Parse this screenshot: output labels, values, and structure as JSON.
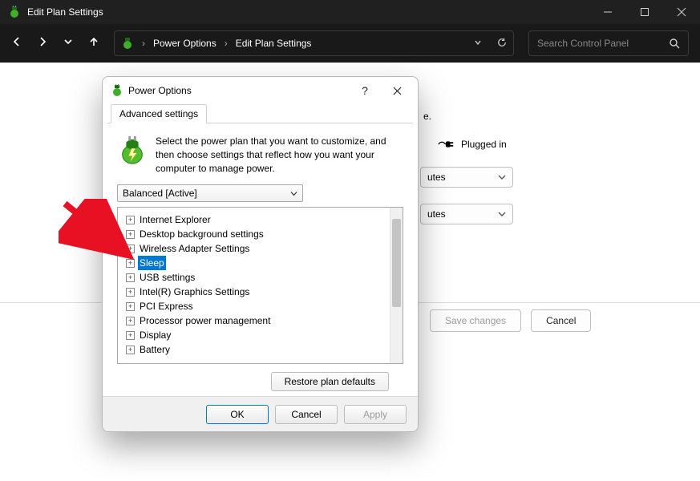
{
  "window": {
    "title": "Edit Plan Settings"
  },
  "address": {
    "crumb1": "Power Options",
    "crumb2": "Edit Plan Settings",
    "search_placeholder": "Search Control Panel"
  },
  "background": {
    "plugged_in": "Plugged in",
    "utes": "utes",
    "e_period": "e.",
    "save_changes": "Save changes",
    "cancel": "Cancel"
  },
  "dialog": {
    "title": "Power Options",
    "tab": "Advanced settings",
    "intro": "Select the power plan that you want to customize, and then choose settings that reflect how you want your computer to manage power.",
    "plan": "Balanced [Active]",
    "tree": [
      "Internet Explorer",
      "Desktop background settings",
      "Wireless Adapter Settings",
      "Sleep",
      "USB settings",
      "Intel(R) Graphics Settings",
      "PCI Express",
      "Processor power management",
      "Display",
      "Battery"
    ],
    "selected_index": 3,
    "restore": "Restore plan defaults",
    "ok": "OK",
    "cancel": "Cancel",
    "apply": "Apply"
  }
}
